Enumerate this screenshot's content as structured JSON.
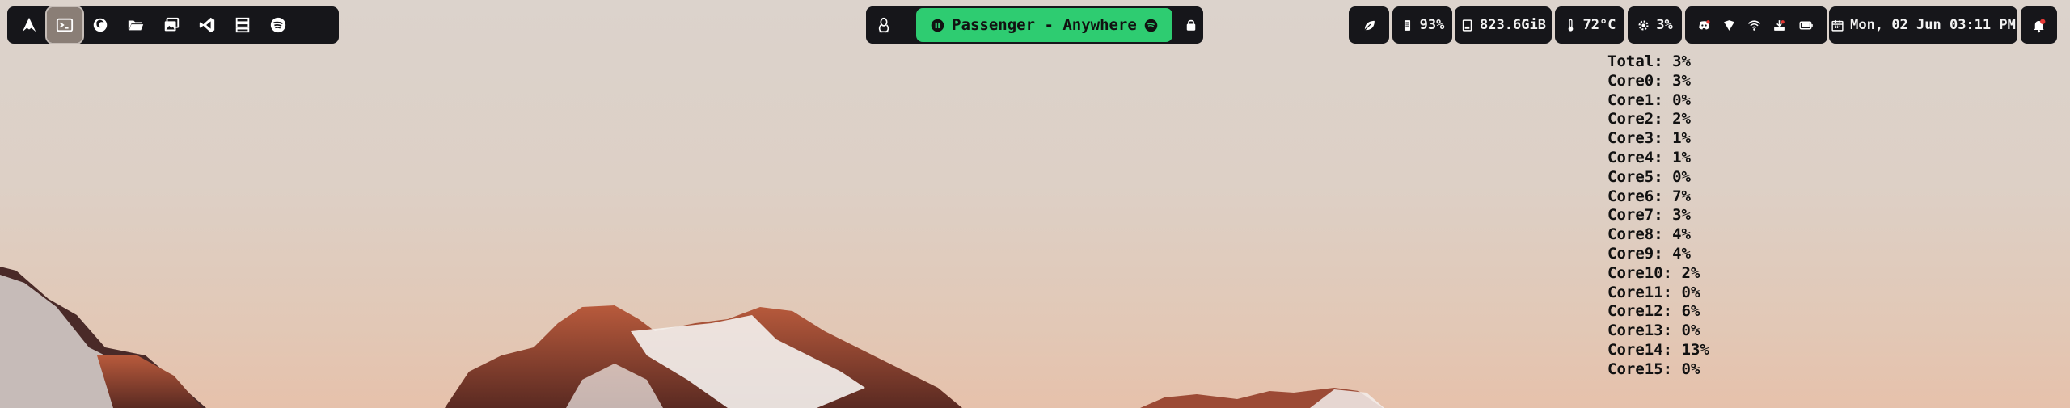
{
  "launcher": {
    "items": [
      {
        "icon": "arch-logo-icon"
      },
      {
        "icon": "terminal-icon",
        "active": true
      },
      {
        "icon": "firefox-icon"
      },
      {
        "icon": "folder-open-icon"
      },
      {
        "icon": "image-gallery-icon"
      },
      {
        "icon": "vscode-icon"
      },
      {
        "icon": "server-stack-icon"
      },
      {
        "icon": "spotify-icon"
      }
    ]
  },
  "media": {
    "now_playing": "Passenger - Anywhere",
    "accent": "#2ecc71",
    "left_icon": "tux-icon",
    "right_icon": "lock-icon"
  },
  "status": {
    "memory": "93%",
    "disk": "823.6GiB",
    "temperature": "72°C",
    "cpu": "3%",
    "datetime": "Mon, 02 Jun 03:11 PM"
  },
  "cpu_widget": {
    "lines": [
      "Total: 3%",
      "Core0: 3%",
      "Core1: 0%",
      "Core2: 2%",
      "Core3: 1%",
      "Core4: 1%",
      "Core5: 0%",
      "Core6: 7%",
      "Core7: 3%",
      "Core8: 4%",
      "Core9: 4%",
      "Core10: 2%",
      "Core11: 0%",
      "Core12: 6%",
      "Core13: 0%",
      "Core14: 13%",
      "Core15: 0%"
    ]
  },
  "colors": {
    "bar_bg": "#16161a",
    "text": "#f2f2f2",
    "media_green": "#2ecc71",
    "notification_red": "#e53935"
  }
}
